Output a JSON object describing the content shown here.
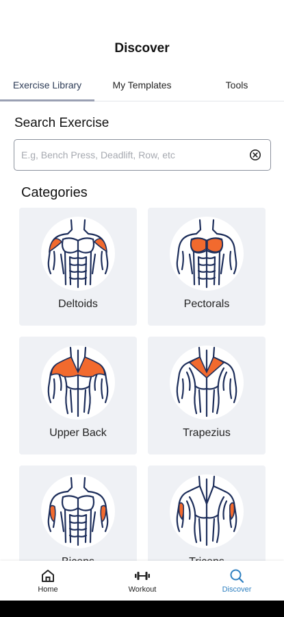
{
  "header": {
    "title": "Discover"
  },
  "tabs": [
    {
      "label": "Exercise Library",
      "active": true
    },
    {
      "label": "My Templates",
      "active": false
    },
    {
      "label": "Tools",
      "active": false
    }
  ],
  "search": {
    "label": "Search Exercise",
    "placeholder": "E.g, Bench Press, Deadlift, Row, etc",
    "value": "",
    "clear_icon": "clear-circle-icon"
  },
  "categories": {
    "title": "Categories",
    "items": [
      {
        "label": "Deltoids",
        "view": "front",
        "highlight": "deltoids"
      },
      {
        "label": "Pectorals",
        "view": "front",
        "highlight": "pectorals"
      },
      {
        "label": "Upper Back",
        "view": "back",
        "highlight": "upper-back"
      },
      {
        "label": "Trapezius",
        "view": "back",
        "highlight": "trapezius"
      },
      {
        "label": "Biceps",
        "view": "front",
        "highlight": "biceps"
      },
      {
        "label": "Triceps",
        "view": "back",
        "highlight": "triceps"
      }
    ]
  },
  "bottom_nav": [
    {
      "label": "Home",
      "icon": "home-icon",
      "active": false
    },
    {
      "label": "Workout",
      "icon": "dumbbell-icon",
      "active": false
    },
    {
      "label": "Discover",
      "icon": "search-icon",
      "active": true
    }
  ],
  "colors": {
    "accent": "#2d7fc0",
    "muscle_highlight": "#f26a2e",
    "figure_stroke": "#1c2d5a",
    "card_bg": "#eff1f5"
  }
}
